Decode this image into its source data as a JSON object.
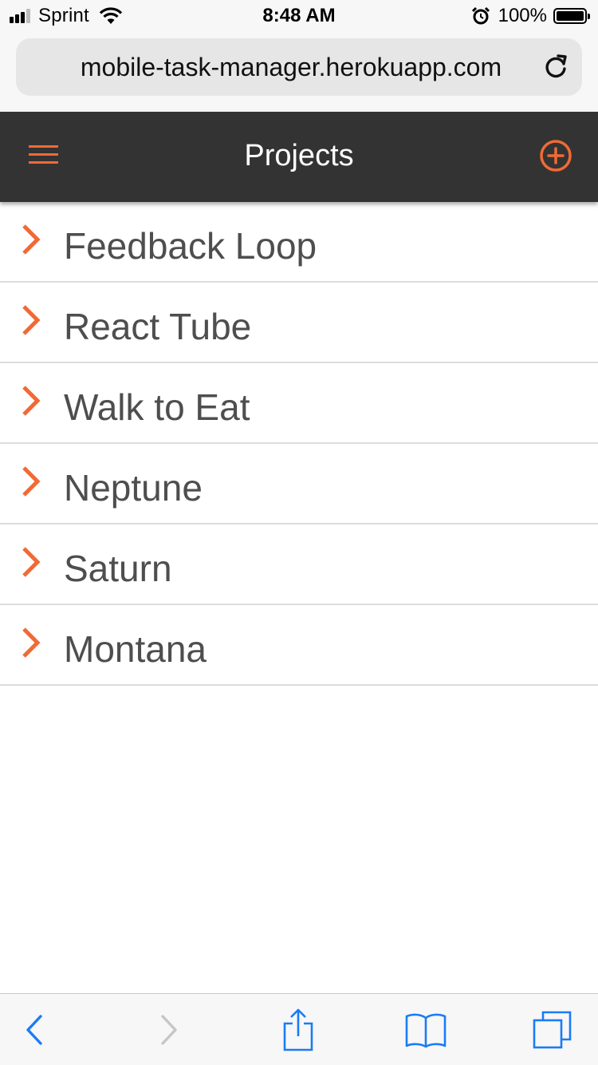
{
  "status_bar": {
    "carrier": "Sprint",
    "time": "8:48 AM",
    "battery": "100%",
    "icons": [
      "signal-icon",
      "wifi-icon",
      "alarm-icon",
      "battery-icon"
    ]
  },
  "browser": {
    "url": "mobile-task-manager.herokuapp.com",
    "icons": [
      "reload-icon"
    ]
  },
  "header": {
    "title": "Projects",
    "icons": [
      "menu-icon",
      "add-icon"
    ]
  },
  "projects": [
    {
      "name": "Feedback Loop"
    },
    {
      "name": "React Tube"
    },
    {
      "name": "Walk to Eat"
    },
    {
      "name": "Neptune"
    },
    {
      "name": "Saturn"
    },
    {
      "name": "Montana"
    }
  ],
  "toolbar": {
    "icons": [
      "back-icon",
      "forward-icon",
      "share-icon",
      "bookmarks-icon",
      "tabs-icon"
    ]
  },
  "colors": {
    "accent": "#f06a35",
    "header_bg": "#333333",
    "ios_blue": "#1a7cf5",
    "text": "#4e4e4e"
  }
}
